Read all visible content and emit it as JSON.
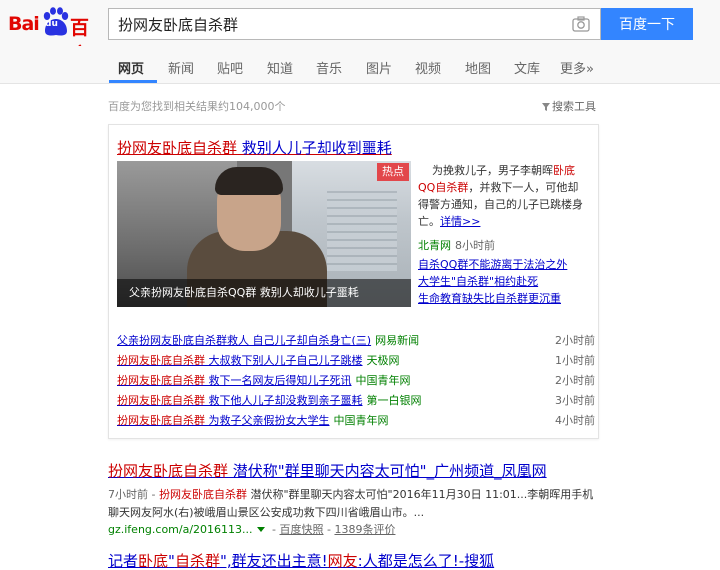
{
  "logo": {
    "left": "Bai",
    "mid": "du",
    "right": "百度"
  },
  "search": {
    "query": "扮网友卧底自杀群",
    "button_label": "百度一下"
  },
  "tabs": [
    "网页",
    "新闻",
    "贴吧",
    "知道",
    "音乐",
    "图片",
    "视频",
    "地图",
    "文库",
    "更多»"
  ],
  "result_count": "百度为您找到相关结果约104,000个",
  "tools_label": "搜索工具",
  "news_card": {
    "title_red": "扮网友卧底自杀群",
    "title_rest": " 救别人儿子却收到噩耗",
    "hot_badge": "热点",
    "image_caption": "父亲扮网友卧底自杀QQ群 救别人却收儿子噩耗",
    "summary": {
      "p1": "为挽救儿子，男子李朝晖",
      "p2": "卧底QQ自杀群",
      "p3": "，并救下一人，可他却得警方通知，自己的儿子已跳楼身亡。",
      "more": "详情>>"
    },
    "source": "北青网",
    "source_time": "8小时前",
    "related": [
      {
        "red": "自杀QQ群",
        "rest": "不能游离于法治之外"
      },
      {
        "rest": "大学生",
        "red": "\"自杀群\"",
        "tail": "相约赴死"
      },
      {
        "rest": "生命教育缺失比",
        "red": "自杀群",
        "tail": "更沉重"
      }
    ],
    "items": [
      {
        "title": "父亲扮网友卧底自杀群救人 自己儿子却自杀身亡(三)",
        "source": "网易新闻",
        "time": "2小时前"
      },
      {
        "title_red": "扮网友卧底自杀群",
        "title_rest": " 大叔救下别人儿子自己儿子跳楼",
        "source": "天极网",
        "time": "1小时前"
      },
      {
        "title_red": "扮网友卧底自杀群",
        "title_rest": " 救下一名网友后得知儿子死讯",
        "source": "中国青年网",
        "time": "2小时前"
      },
      {
        "title_red": "扮网友卧底自杀群",
        "title_rest": " 救下他人儿子却没救到亲子噩耗",
        "source": "第一白银网",
        "time": "3小时前"
      },
      {
        "title_red": "扮网友卧底自杀群",
        "title_rest": " 为救子父亲假扮女大学生",
        "source": "中国青年网",
        "time": "4小时前"
      }
    ]
  },
  "result1": {
    "title_red": "扮网友卧底自杀群",
    "title_rest": " 潜伏称\"群里聊天内容太可怕\"_广州频道_凤凰网",
    "date": "7小时前 - ",
    "snippet_red": "扮网友卧底自杀群",
    "snippet_rest": " 潜伏称\"群里聊天内容太可怕\"2016年11月30日 11:01...李朝晖用手机聊天网友阿水(右)被峨眉山景区公安成功救下四川省峨眉山市。...",
    "url": "gz.ifeng.com/a/2016113...",
    "cache": "百度快照",
    "reviews": "1389条评价"
  },
  "result2": {
    "title_p1": "记者",
    "title_red1": "卧底",
    "title_p2": "\"",
    "title_red2": "自杀群",
    "title_p3": "\",群友还出主意!",
    "title_red3": "网友",
    "title_p4": ":人都是怎么了!-搜狐"
  }
}
